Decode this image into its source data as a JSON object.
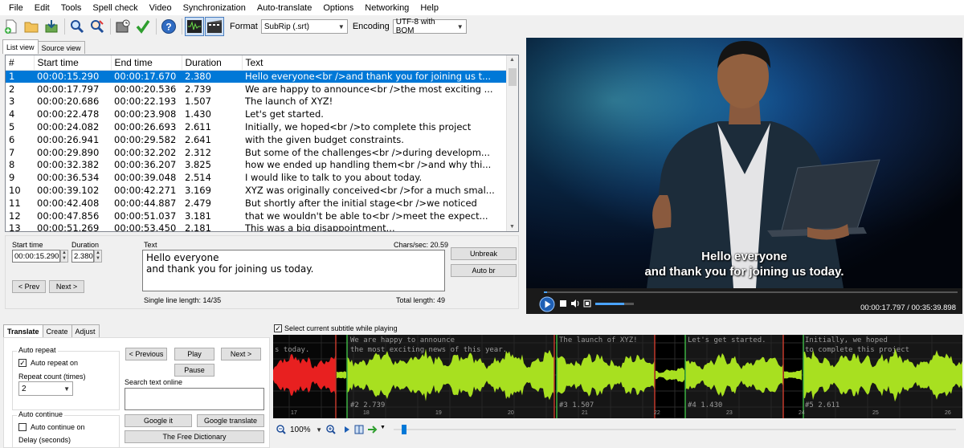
{
  "menu": [
    "File",
    "Edit",
    "Tools",
    "Spell check",
    "Video",
    "Synchronization",
    "Auto-translate",
    "Options",
    "Networking",
    "Help"
  ],
  "toolbar": {
    "format_label": "Format",
    "format_value": "SubRip (.srt)",
    "encoding_label": "Encoding",
    "encoding_value": "UTF-8 with BOM"
  },
  "tabs": [
    "List view",
    "Source view"
  ],
  "list": {
    "headers": [
      "#",
      "Start time",
      "End time",
      "Duration",
      "Text"
    ],
    "rows": [
      [
        "1",
        "00:00:15.290",
        "00:00:17.670",
        "2.380",
        "Hello everyone<br />and thank you for joining us t..."
      ],
      [
        "2",
        "00:00:17.797",
        "00:00:20.536",
        "2.739",
        "We are happy to announce<br />the most exciting ..."
      ],
      [
        "3",
        "00:00:20.686",
        "00:00:22.193",
        "1.507",
        "The launch of XYZ!"
      ],
      [
        "4",
        "00:00:22.478",
        "00:00:23.908",
        "1.430",
        "Let's get started."
      ],
      [
        "5",
        "00:00:24.082",
        "00:00:26.693",
        "2.611",
        "Initially, we hoped<br />to complete this project"
      ],
      [
        "6",
        "00:00:26.941",
        "00:00:29.582",
        "2.641",
        "with the given budget constraints."
      ],
      [
        "7",
        "00:00:29.890",
        "00:00:32.202",
        "2.312",
        "But some of the challenges<br />during developm..."
      ],
      [
        "8",
        "00:00:32.382",
        "00:00:36.207",
        "3.825",
        "how we ended up handling them<br />and why thi..."
      ],
      [
        "9",
        "00:00:36.534",
        "00:00:39.048",
        "2.514",
        "I would like to talk to you about today."
      ],
      [
        "10",
        "00:00:39.102",
        "00:00:42.271",
        "3.169",
        "XYZ was originally conceived<br />for a much smal..."
      ],
      [
        "11",
        "00:00:42.408",
        "00:00:44.887",
        "2.479",
        "But shortly after the initial stage<br />we noticed"
      ],
      [
        "12",
        "00:00:47.856",
        "00:00:51.037",
        "3.181",
        "that we wouldn't be able to<br />meet the expect..."
      ],
      [
        "13",
        "00:00:51.269",
        "00:00:53.450",
        "2.181",
        "This was a big disappointment..."
      ]
    ]
  },
  "edit": {
    "start_label": "Start time",
    "start_value": "00:00:15.290",
    "duration_label": "Duration",
    "duration_value": "2.380",
    "text_label": "Text",
    "chars_sec": "Chars/sec: 20.59",
    "text_value": "Hello everyone\nand thank you for joining us today.",
    "prev": "< Prev",
    "next": "Next >",
    "unbreak": "Unbreak",
    "auto_br": "Auto br",
    "single_line": "Single line length: 14/35",
    "total_length": "Total length: 49"
  },
  "video": {
    "subtitle_line1": "Hello everyone",
    "subtitle_line2": "and thank you for joining us today.",
    "timecode": "00:00:17.797 / 00:35:39.898"
  },
  "bottom_tabs": [
    "Translate",
    "Create",
    "Adjust"
  ],
  "translate": {
    "auto_repeat_title": "Auto repeat",
    "auto_repeat_on": "Auto repeat on",
    "repeat_count_label": "Repeat count (times)",
    "repeat_count_value": "2",
    "auto_continue_title": "Auto continue",
    "auto_continue_on": "Auto continue on",
    "delay_label": "Delay (seconds)",
    "previous": "< Previous",
    "play": "Play",
    "next": "Next >",
    "pause": "Pause",
    "search_label": "Search text online",
    "google_it": "Google it",
    "google_translate": "Google translate",
    "free_dictionary": "The Free Dictionary"
  },
  "waveform": {
    "select_label": "Select current subtitle while playing",
    "zoom": "100%",
    "segments": [
      {
        "line1": "s today.",
        "line2": "",
        "num": ""
      },
      {
        "line1": "We are happy to announce",
        "line2": "the most exciting news of this year.",
        "num": "#2  2.739"
      },
      {
        "line1": "The launch of XYZ!",
        "line2": "",
        "num": "#3  1.507"
      },
      {
        "line1": "Let's get started.",
        "line2": "",
        "num": "#4  1.430"
      },
      {
        "line1": "Initially, we hoped",
        "line2": "to complete this project",
        "num": "#5  2.611"
      }
    ],
    "ticks": [
      "17",
      "18",
      "19",
      "20",
      "21",
      "22",
      "23",
      "24",
      "25",
      "26"
    ]
  },
  "colors": {
    "selection": "#0078d7",
    "wave_current": "#e82020",
    "wave_other": "#a8e020"
  }
}
